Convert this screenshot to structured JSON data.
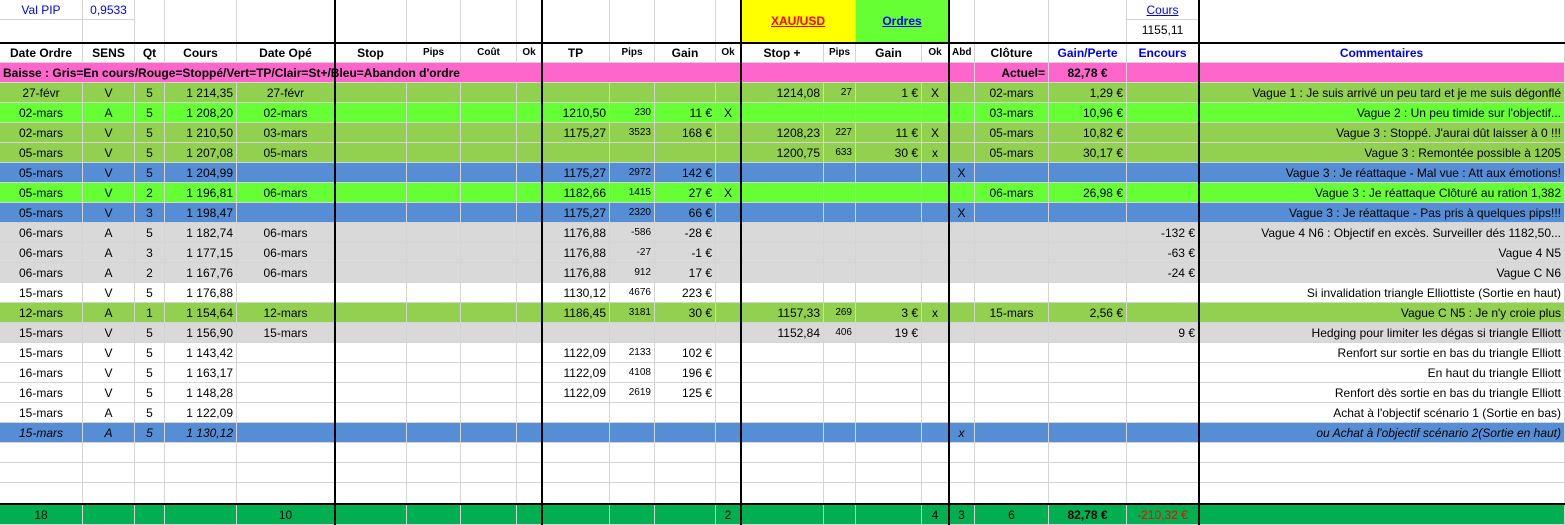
{
  "top": {
    "val_pip_label": "Val PIP",
    "val_pip_value": "0,9533",
    "xau_usd_label": "XAU/USD",
    "ordres_label": "Ordres",
    "cours_label": "Cours",
    "cours_value": "1155,11"
  },
  "headers": [
    "Date Ordre",
    "SENS",
    "Qt",
    "Cours",
    "Date Opé",
    "Stop",
    "Pips",
    "Coût",
    "Ok",
    "TP",
    "Pips",
    "Gain",
    "Ok",
    "Stop +",
    "Pips",
    "Gain",
    "Ok",
    "Abd",
    "Clôture",
    "Gain/Perte",
    "Encours",
    "Commentaires"
  ],
  "legend": {
    "text": "Baisse : Gris=En cours/Rouge=Stoppé/Vert=TP/Clair=St+/Bleu=Abandon d'ordre",
    "actuel_label": "Actuel=",
    "actuel_value": "82,78 €"
  },
  "rows": [
    {
      "bg": "#92d050",
      "italic": false,
      "cells": [
        "27-févr",
        "V",
        "5",
        "1 214,35",
        "27-févr",
        "",
        "",
        "",
        "",
        "",
        "",
        "",
        "",
        "1214,08",
        "27",
        "1 €",
        "X",
        "",
        "02-mars",
        "1,29 €",
        "",
        "Vague 1 : Je suis arrivé un peu tard et je me suis dégonflé"
      ]
    },
    {
      "bg": "#66ff33",
      "italic": false,
      "cells": [
        "02-mars",
        "A",
        "5",
        "1 208,20",
        "02-mars",
        "",
        "",
        "",
        "",
        "1210,50",
        "230",
        "11 €",
        "X",
        "",
        "",
        "",
        "",
        "",
        "03-mars",
        "10,96 €",
        "",
        "Vague 2 : Un peu timide sur l'objectif..."
      ]
    },
    {
      "bg": "#92d050",
      "italic": false,
      "cells": [
        "02-mars",
        "V",
        "5",
        "1 210,50",
        "03-mars",
        "",
        "",
        "",
        "",
        "1175,27",
        "3523",
        "168 €",
        "",
        "1208,23",
        "227",
        "11 €",
        "X",
        "",
        "05-mars",
        "10,82 €",
        "",
        "Vague 3 : Stoppé. J'aurai dût laisser à 0 !!!"
      ]
    },
    {
      "bg": "#92d050",
      "italic": false,
      "cells": [
        "05-mars",
        "V",
        "5",
        "1 207,08",
        "05-mars",
        "",
        "",
        "",
        "",
        "",
        "",
        "",
        "",
        "1200,75",
        "633",
        "30 €",
        "x",
        "",
        "05-mars",
        "30,17 €",
        "",
        "Vague 3 : Remontée possible à 1205"
      ]
    },
    {
      "bg": "#558ed5",
      "italic": false,
      "cells": [
        "05-mars",
        "V",
        "5",
        "1 204,99",
        "",
        "",
        "",
        "",
        "",
        "1175,27",
        "2972",
        "142 €",
        "",
        "",
        "",
        "",
        "",
        "X",
        "",
        "",
        "",
        "Vague 3 : Je réattaque - Mal vue : Att aux émotions!"
      ]
    },
    {
      "bg": "#66ff33",
      "italic": false,
      "cells": [
        "05-mars",
        "V",
        "2",
        "1 196,81",
        "06-mars",
        "",
        "",
        "",
        "",
        "1182,66",
        "1415",
        "27 €",
        "X",
        "",
        "",
        "",
        "",
        "",
        "06-mars",
        "26,98 €",
        "",
        "Vague 3 : Je réattaque Clôturé au ration 1,382"
      ]
    },
    {
      "bg": "#558ed5",
      "italic": false,
      "cells": [
        "05-mars",
        "V",
        "3",
        "1 198,47",
        "",
        "",
        "",
        "",
        "",
        "1175,27",
        "2320",
        "66 €",
        "",
        "",
        "",
        "",
        "",
        "X",
        "",
        "",
        "",
        "Vague 3 : Je réattaque - Pas pris à quelques pips!!!"
      ]
    },
    {
      "bg": "#d9d9d9",
      "italic": false,
      "cells": [
        "06-mars",
        "A",
        "5",
        "1 182,74",
        "06-mars",
        "",
        "",
        "",
        "",
        "1176,88",
        "-586",
        "-28 €",
        "",
        "",
        "",
        "",
        "",
        "",
        "",
        "",
        "-132 €",
        "Vague 4 N6 : Objectif en excès. Surveiller dés 1182,50..."
      ]
    },
    {
      "bg": "#d9d9d9",
      "italic": false,
      "cells": [
        "06-mars",
        "A",
        "3",
        "1 177,15",
        "06-mars",
        "",
        "",
        "",
        "",
        "1176,88",
        "-27",
        "-1 €",
        "",
        "",
        "",
        "",
        "",
        "",
        "",
        "",
        "-63 €",
        "Vague 4 N5"
      ]
    },
    {
      "bg": "#d9d9d9",
      "italic": false,
      "cells": [
        "06-mars",
        "A",
        "2",
        "1 167,76",
        "06-mars",
        "",
        "",
        "",
        "",
        "1176,88",
        "912",
        "17 €",
        "",
        "",
        "",
        "",
        "",
        "",
        "",
        "",
        "-24 €",
        "Vague C N6"
      ]
    },
    {
      "bg": "#ffffff",
      "italic": false,
      "cells": [
        "15-mars",
        "V",
        "5",
        "1 176,88",
        "",
        "",
        "",
        "",
        "",
        "1130,12",
        "4676",
        "223 €",
        "",
        "",
        "",
        "",
        "",
        "",
        "",
        "",
        "",
        "Si invalidation triangle Elliottiste (Sortie en haut)"
      ]
    },
    {
      "bg": "#92d050",
      "italic": false,
      "cells": [
        "12-mars",
        "A",
        "1",
        "1 154,64",
        "12-mars",
        "",
        "",
        "",
        "",
        "1186,45",
        "3181",
        "30 €",
        "",
        "1157,33",
        "269",
        "3 €",
        "x",
        "",
        "15-mars",
        "2,56 €",
        "",
        "Vague C N5 : Je n'y croie plus"
      ]
    },
    {
      "bg": "#d9d9d9",
      "italic": false,
      "cells": [
        "15-mars",
        "V",
        "5",
        "1 156,90",
        "15-mars",
        "",
        "",
        "",
        "",
        "",
        "",
        "",
        "",
        "1152,84",
        "406",
        "19 €",
        "",
        "",
        "",
        "",
        "9 €",
        "Hedging pour limiter les dégas si triangle Elliott"
      ]
    },
    {
      "bg": "#ffffff",
      "italic": false,
      "cells": [
        "15-mars",
        "V",
        "5",
        "1 143,42",
        "",
        "",
        "",
        "",
        "",
        "1122,09",
        "2133",
        "102 €",
        "",
        "",
        "",
        "",
        "",
        "",
        "",
        "",
        "",
        "Renfort sur sortie en bas du triangle Elliott"
      ]
    },
    {
      "bg": "#ffffff",
      "italic": false,
      "cells": [
        "16-mars",
        "V",
        "5",
        "1 163,17",
        "",
        "",
        "",
        "",
        "",
        "1122,09",
        "4108",
        "196 €",
        "",
        "",
        "",
        "",
        "",
        "",
        "",
        "",
        "",
        "En haut du triangle Elliott"
      ]
    },
    {
      "bg": "#ffffff",
      "italic": false,
      "cells": [
        "16-mars",
        "V",
        "5",
        "1 148,28",
        "",
        "",
        "",
        "",
        "",
        "1122,09",
        "2619",
        "125 €",
        "",
        "",
        "",
        "",
        "",
        "",
        "",
        "",
        "",
        "Renfort dès sortie en bas du triangle Elliott"
      ]
    },
    {
      "bg": "#ffffff",
      "italic": false,
      "cells": [
        "15-mars",
        "A",
        "5",
        "1 122,09",
        "",
        "",
        "",
        "",
        "",
        "",
        "",
        "",
        "",
        "",
        "",
        "",
        "",
        "",
        "",
        "",
        "",
        "Achat à l'objectif scénario 1 (Sortie en bas)"
      ]
    },
    {
      "bg": "#558ed5",
      "italic": true,
      "cells": [
        "15-mars",
        "A",
        "5",
        "1 130,12",
        "",
        "",
        "",
        "",
        "",
        "",
        "",
        "",
        "",
        "",
        "",
        "",
        "",
        "x",
        "",
        "",
        "",
        "ou Achat à l'objectif scénario 2(Sortie en haut)"
      ]
    }
  ],
  "totals": [
    "18",
    "",
    "",
    "",
    "10",
    "",
    "",
    "",
    "",
    "",
    "",
    "",
    "2",
    "",
    "",
    "",
    "4",
    "3",
    "6",
    "82,78 €",
    "-210,32 €",
    ""
  ]
}
